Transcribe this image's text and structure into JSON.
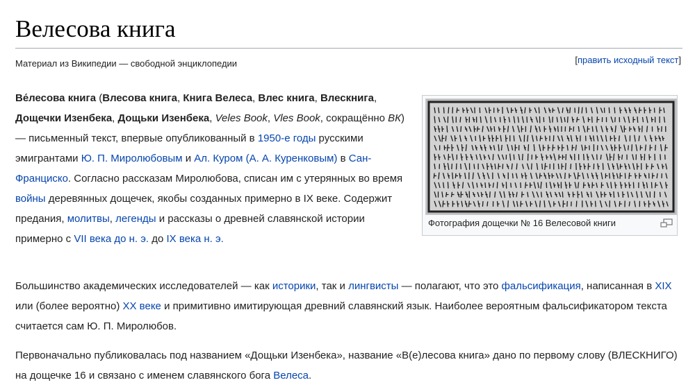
{
  "page": {
    "title": "Велесова книга",
    "subtitle": "Материал из Википедии — свободной энциклопедии",
    "edit": {
      "open": "[",
      "label": "править исходный текст",
      "close": "]"
    }
  },
  "thumb": {
    "caption": "Фотография дощечки № 16 Велесовой книги",
    "icon": "magnify-icon"
  },
  "p1": [
    {
      "t": "Ве́лесова книга",
      "s": "b"
    },
    {
      "t": " ("
    },
    {
      "t": "Влесова книга",
      "s": "b"
    },
    {
      "t": ", "
    },
    {
      "t": "Книга Велеса",
      "s": "b"
    },
    {
      "t": ", "
    },
    {
      "t": "Влес книга",
      "s": "b"
    },
    {
      "t": ", "
    },
    {
      "t": "Влескнига",
      "s": "b"
    },
    {
      "t": ", "
    },
    {
      "t": "Дощечки Изенбека",
      "s": "b"
    },
    {
      "t": ", "
    },
    {
      "t": "Дощьки Изенбека",
      "s": "b"
    },
    {
      "t": ", "
    },
    {
      "t": "Veles Book",
      "s": "i"
    },
    {
      "t": ", "
    },
    {
      "t": "Vles Book",
      "s": "i"
    },
    {
      "t": ", сокращённо "
    },
    {
      "t": "ВК",
      "s": "i"
    },
    {
      "t": ") — письменный текст, впервые опубликованный в "
    },
    {
      "t": "1950-е годы",
      "s": "a"
    },
    {
      "t": " русскими эмигрантами "
    },
    {
      "t": "Ю. П. Миролюбовым",
      "s": "a"
    },
    {
      "t": " и "
    },
    {
      "t": "Ал. Куром (А. А. Куренковым)",
      "s": "a"
    },
    {
      "t": " в "
    },
    {
      "t": "Сан-Франциско",
      "s": "a"
    },
    {
      "t": ". Согласно рассказам Миролюбова, списан им с утерянных во время "
    },
    {
      "t": "войны",
      "s": "a"
    },
    {
      "t": " деревянных дощечек, якобы созданных примерно в IX веке. Содержит предания, "
    },
    {
      "t": "молитвы",
      "s": "a"
    },
    {
      "t": ", "
    },
    {
      "t": "легенды",
      "s": "a"
    },
    {
      "t": " и рассказы о древней славянской истории примерно с "
    },
    {
      "t": "VII века до н. э.",
      "s": "a"
    },
    {
      "t": " до "
    },
    {
      "t": "IX века н. э.",
      "s": "a"
    }
  ],
  "p2": [
    {
      "t": "Большинство академических исследователей — как "
    },
    {
      "t": "историки",
      "s": "a"
    },
    {
      "t": ", так и "
    },
    {
      "t": "лингвисты",
      "s": "a"
    },
    {
      "t": " — полагают, что это "
    },
    {
      "t": "фальсификация",
      "s": "a"
    },
    {
      "t": ", написанная в "
    },
    {
      "t": "XIX",
      "s": "a"
    },
    {
      "t": " или (более вероятно) "
    },
    {
      "t": "XX веке",
      "s": "a"
    },
    {
      "t": " и примитивно имитирующая древний славянский язык. Наиболее вероятным фальсификатором текста считается сам Ю. П. Миролюбов."
    }
  ],
  "p3": [
    {
      "t": "Первоначально публиковалась под названием «Дощьки Изенбека», название «В(е)лесова книга» дано по первому слову (ВЛЕСКНИГО) на дощечке 16 и связано с именем славянского бога "
    },
    {
      "t": "Велеса",
      "s": "a"
    },
    {
      "t": "."
    }
  ],
  "colors": {
    "link": "#0645ad",
    "text": "#222222",
    "rule": "#a2a9b1"
  }
}
